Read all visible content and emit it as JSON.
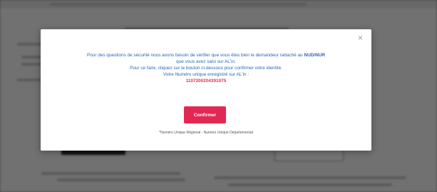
{
  "modal": {
    "close_symbol": "×",
    "line1_a": "Pour des questions de sécurité nous avons besoin de vérifier que vous êtes bien le demandeur rattaché au ",
    "line1_b": "NUD/NUR",
    "line2": "que vous avez saisi sur AL'in.",
    "line3": "Pour ce faire, cliquez sur le bouton ci-dessous pour confirmer votre identité.",
    "label": "Votre Numéro unique enregistré sur AL'in :",
    "number": "1107200204391075",
    "confirm_label": "Confirmer",
    "footnote": "*Numéro Unique Régional - Numéro Unique Départemental"
  },
  "colors": {
    "link_blue": "#2a66b8",
    "accent_red": "#e32753"
  }
}
